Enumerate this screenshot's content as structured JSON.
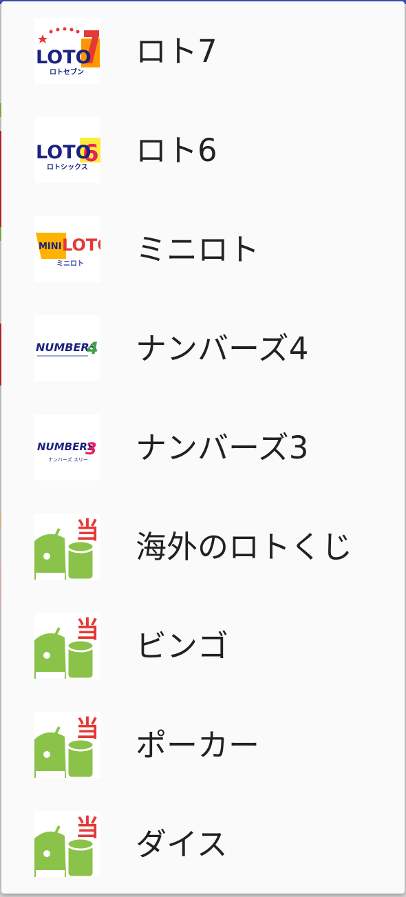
{
  "menu": {
    "items": [
      {
        "label": "ロト7",
        "icon": "loto7-logo-icon",
        "logo_text": "LOTO",
        "logo_number": "7",
        "logo_caption": "ロトセブン"
      },
      {
        "label": "ロト6",
        "icon": "loto6-logo-icon",
        "logo_text": "LOTO",
        "logo_number": "6",
        "logo_caption": "ロトシックス"
      },
      {
        "label": "ミニロト",
        "icon": "miniloto-logo-icon",
        "logo_text": "MINI LOTO",
        "logo_caption": "ミニロト"
      },
      {
        "label": "ナンバーズ4",
        "icon": "numbers4-logo-icon",
        "logo_text": "NUMBERS",
        "logo_number": "4"
      },
      {
        "label": "ナンバーズ3",
        "icon": "numbers3-logo-icon",
        "logo_text": "NUMBERS",
        "logo_number": "3",
        "logo_caption": "ナンバーズ スリー"
      },
      {
        "label": "海外のロトくじ",
        "icon": "android-atari-icon",
        "badge": "当"
      },
      {
        "label": "ビンゴ",
        "icon": "android-atari-icon",
        "badge": "当"
      },
      {
        "label": "ポーカー",
        "icon": "android-atari-icon",
        "badge": "当"
      },
      {
        "label": "ダイス",
        "icon": "android-atari-icon",
        "badge": "当"
      }
    ]
  },
  "colors": {
    "drawer_bg": "#fafafa",
    "text": "#212121",
    "android_green": "#8bc34a",
    "badge_red": "#e53935",
    "app_bar": "#3f51b5"
  }
}
